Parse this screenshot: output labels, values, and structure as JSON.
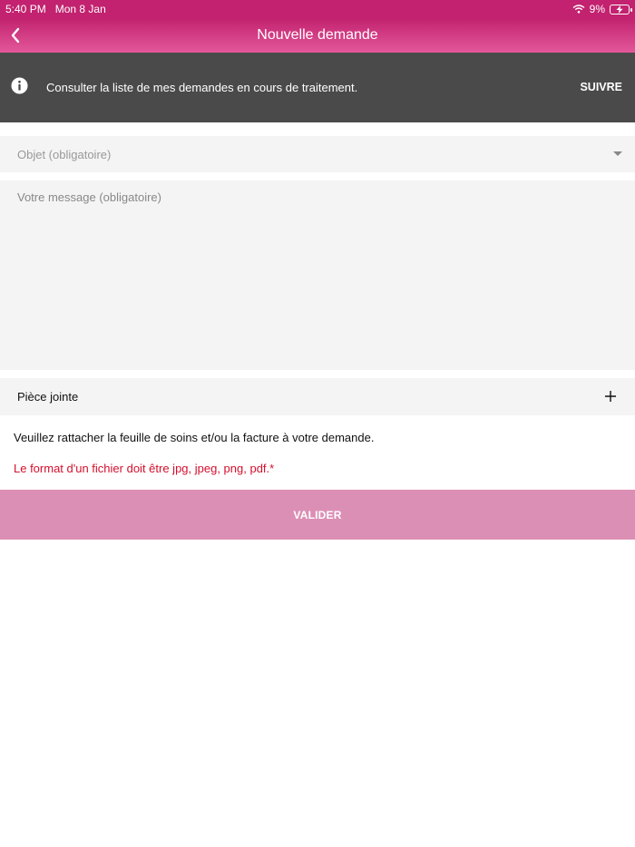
{
  "status_bar": {
    "time": "5:40 PM",
    "date": "Mon 8 Jan",
    "battery": "9%"
  },
  "nav": {
    "title": "Nouvelle demande"
  },
  "info_banner": {
    "text": "Consulter la liste de mes demandes en cours de traitement.",
    "action": "SUIVRE"
  },
  "form": {
    "subject_placeholder": "Objet (obligatoire)",
    "message_placeholder": "Votre message (obligatoire)",
    "message_value": "",
    "attachment_label": "Pièce jointe",
    "attach_note": "Veuillez rattacher la feuille de soins et/ou la facture à votre demande.",
    "format_warning": "Le format d'un fichier doit être jpg, jpeg, png, pdf.*",
    "submit_label": "VALIDER"
  },
  "colors": {
    "brand": "#c2226f",
    "banner_bg": "#4a4a4a",
    "field_bg": "#f4f4f4",
    "warning": "#d40f2d",
    "submit_disabled": "#dc8fb5"
  }
}
